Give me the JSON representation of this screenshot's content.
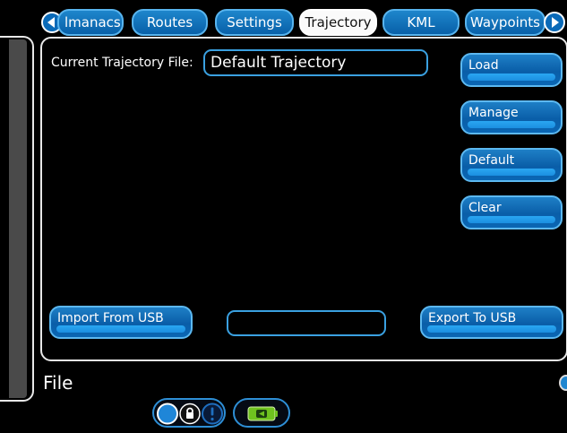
{
  "tabs": [
    {
      "label": "lmanacs"
    },
    {
      "label": "Routes"
    },
    {
      "label": "Settings"
    },
    {
      "label": "Trajectory",
      "active": true
    },
    {
      "label": "KML"
    },
    {
      "label": "Waypoints"
    }
  ],
  "trajectory": {
    "current_file_label": "Current Trajectory File:",
    "current_file_value": "Default Trajectory"
  },
  "actions": {
    "load": "Load",
    "manage": "Manage",
    "default": "Default",
    "clear": "Clear"
  },
  "usb": {
    "import_label": "Import From USB",
    "export_label": "Export To USB",
    "status_value": ""
  },
  "footer": {
    "title": "File"
  },
  "icons": {
    "prev": "chevron-left-icon",
    "next": "chevron-right-icon",
    "lock": "lock-icon",
    "alert": "alert-icon",
    "battery": "battery-icon"
  },
  "colors": {
    "accent": "#0a6ab8",
    "tab_active_bg": "#fafafa",
    "battery_green": "#6fc21f"
  }
}
